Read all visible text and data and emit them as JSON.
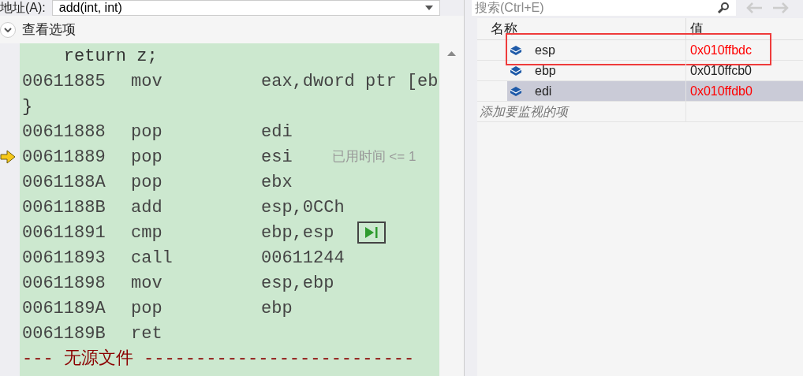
{
  "address": {
    "label": "地址(A):",
    "value": "add(int, int)"
  },
  "view_options": {
    "label": "查看选项"
  },
  "code_lines": [
    {
      "kind": "source",
      "text": "    return z;"
    },
    {
      "kind": "instr",
      "addr": "00611885",
      "op": "mov",
      "args": "eax,dword ptr [eb",
      "current": false
    },
    {
      "kind": "source",
      "text": "}"
    },
    {
      "kind": "instr",
      "addr": "00611888",
      "op": "pop",
      "args": "edi",
      "current": false
    },
    {
      "kind": "instr",
      "addr": "00611889",
      "op": "pop",
      "args": "esi",
      "current": true,
      "note": "已用时间 <= 1"
    },
    {
      "kind": "instr",
      "addr": "0061188A",
      "op": "pop",
      "args": "ebx",
      "current": false
    },
    {
      "kind": "instr",
      "addr": "0061188B",
      "op": "add",
      "args": "esp,0CCh",
      "current": false
    },
    {
      "kind": "instr",
      "addr": "00611891",
      "op": "cmp",
      "args": "ebp,esp",
      "current": false,
      "run_to_click": true
    },
    {
      "kind": "instr",
      "addr": "00611893",
      "op": "call",
      "args": "00611244",
      "current": false
    },
    {
      "kind": "instr",
      "addr": "00611898",
      "op": "mov",
      "args": "esp,ebp",
      "current": false
    },
    {
      "kind": "instr",
      "addr": "0061189A",
      "op": "pop",
      "args": "ebp",
      "current": false
    },
    {
      "kind": "instr",
      "addr": "0061189B",
      "op": "ret",
      "current": false
    },
    {
      "kind": "separator",
      "text": "--- 无源文件 --------------------------"
    }
  ],
  "watch": {
    "search": {
      "placeholder": "搜索(Ctrl+E)"
    },
    "columns": [
      "名称",
      "值"
    ],
    "rows": [
      {
        "name": "esp",
        "value": "0x010ffbdc",
        "changed": true,
        "selected": false,
        "highlighted": true
      },
      {
        "name": "ebp",
        "value": "0x010ffcb0",
        "changed": false,
        "selected": false,
        "highlighted": false
      },
      {
        "name": "edi",
        "value": "0x010ffdb0",
        "changed": true,
        "selected": true,
        "highlighted": false
      }
    ],
    "add_item": "添加要监视的项"
  }
}
